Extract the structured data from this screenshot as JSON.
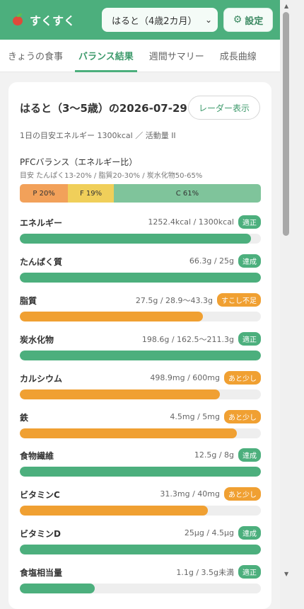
{
  "app": {
    "name": "すくすく"
  },
  "header": {
    "child_selector": "はると（4歳2カ月）",
    "settings_label": "設定"
  },
  "tabs": [
    {
      "label": "きょうの食事",
      "active": false
    },
    {
      "label": "バランス結果",
      "active": true
    },
    {
      "label": "週間サマリー",
      "active": false
    },
    {
      "label": "成長曲線",
      "active": false
    }
  ],
  "result": {
    "title": "はると（3〜5歳）の2026-07-29",
    "radar_button": "レーダー表示",
    "energy_target": "1日の目安エネルギー 1300kcal ／ 活動量 II",
    "pfc": {
      "title": "PFCバランス（エネルギー比）",
      "subtitle": "目安 たんぱく13-20% / 脂質20-30% / 炭水化物50-65%",
      "segments": [
        {
          "label": "P 20%",
          "percent": 20,
          "color": "#f2a15a"
        },
        {
          "label": "F 19%",
          "percent": 19,
          "color": "#f0cf5a"
        },
        {
          "label": "C 61%",
          "percent": 61,
          "color": "#7fc49b"
        }
      ]
    },
    "nutrients": [
      {
        "name": "エネルギー",
        "value": "1252.4kcal / 1300kcal",
        "status": "適正",
        "status_color": "green",
        "progress": 0.96
      },
      {
        "name": "たんぱく質",
        "value": "66.3g / 25g",
        "status": "達成",
        "status_color": "green",
        "progress": 1.0
      },
      {
        "name": "脂質",
        "value": "27.5g / 28.9〜43.3g",
        "status": "すこし不足",
        "status_color": "orange",
        "progress": 0.76
      },
      {
        "name": "炭水化物",
        "value": "198.6g / 162.5〜211.3g",
        "status": "適正",
        "status_color": "green",
        "progress": 1.0
      },
      {
        "name": "カルシウム",
        "value": "498.9mg / 600mg",
        "status": "あと少し",
        "status_color": "orange",
        "progress": 0.83
      },
      {
        "name": "鉄",
        "value": "4.5mg / 5mg",
        "status": "あと少し",
        "status_color": "orange",
        "progress": 0.9
      },
      {
        "name": "食物繊維",
        "value": "12.5g / 8g",
        "status": "達成",
        "status_color": "green",
        "progress": 1.0
      },
      {
        "name": "ビタミンC",
        "value": "31.3mg / 40mg",
        "status": "あと少し",
        "status_color": "orange",
        "progress": 0.78
      },
      {
        "name": "ビタミンD",
        "value": "25μg / 4.5μg",
        "status": "達成",
        "status_color": "green",
        "progress": 1.0
      },
      {
        "name": "食塩相当量",
        "value": "1.1g / 3.5g未満",
        "status": "適正",
        "status_color": "green",
        "progress": 0.31
      }
    ]
  }
}
